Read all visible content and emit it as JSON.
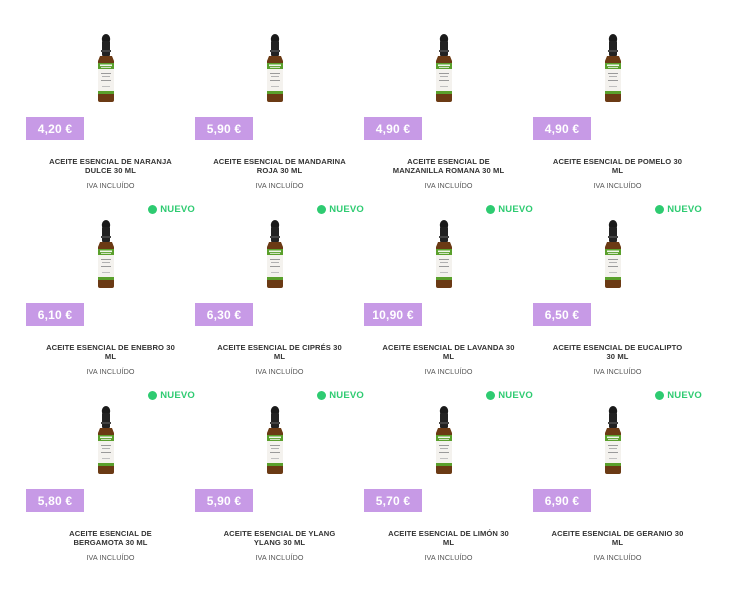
{
  "products": [
    {
      "title": "ACEITE ESENCIAL DE NARANJA DULCE 30 ML",
      "price": "4,20 €",
      "iva": "IVA INCLUÍDO",
      "badge": ""
    },
    {
      "title": "ACEITE ESENCIAL DE MANDARINA ROJA 30 ML",
      "price": "5,90 €",
      "iva": "IVA INCLUÍDO",
      "badge": ""
    },
    {
      "title": "ACEITE ESENCIAL DE MANZANILLA ROMANA 30 ML",
      "price": "4,90 €",
      "iva": "IVA INCLUÍDO",
      "badge": ""
    },
    {
      "title": "ACEITE ESENCIAL DE POMELO 30 ML",
      "price": "4,90 €",
      "iva": "IVA INCLUÍDO",
      "badge": ""
    },
    {
      "title": "ACEITE ESENCIAL DE ENEBRO 30 ML",
      "price": "6,10 €",
      "iva": "IVA INCLUÍDO",
      "badge": "NUEVO"
    },
    {
      "title": "ACEITE ESENCIAL DE CIPRÉS 30 ML",
      "price": "6,30 €",
      "iva": "IVA INCLUÍDO",
      "badge": "NUEVO"
    },
    {
      "title": "ACEITE ESENCIAL DE LAVANDA 30 ML",
      "price": "10,90 €",
      "iva": "IVA INCLUÍDO",
      "badge": "NUEVO"
    },
    {
      "title": "ACEITE ESENCIAL DE EUCALIPTO 30 ML",
      "price": "6,50 €",
      "iva": "IVA INCLUÍDO",
      "badge": "NUEVO"
    },
    {
      "title": "ACEITE ESENCIAL DE BERGAMOTA 30 ML",
      "price": "5,80 €",
      "iva": "IVA INCLUÍDO",
      "badge": "NUEVO"
    },
    {
      "title": "ACEITE ESENCIAL DE YLANG YLANG 30 ML",
      "price": "5,90 €",
      "iva": "IVA INCLUÍDO",
      "badge": "NUEVO"
    },
    {
      "title": "ACEITE ESENCIAL DE LIMÓN 30 ML",
      "price": "5,70 €",
      "iva": "IVA INCLUÍDO",
      "badge": "NUEVO"
    },
    {
      "title": "ACEITE ESENCIAL DE GERANIO 30 ML",
      "price": "6,90 €",
      "iva": "IVA INCLUÍDO",
      "badge": "NUEVO"
    }
  ],
  "colors": {
    "price_bg": "#c79ae6",
    "badge_green": "#2ecb71",
    "bottle_glass": "#6b3a14",
    "label_green": "#5aa02c"
  },
  "icons": {
    "product_image": "essential-oil-dropper-bottle",
    "badge_dot": "green-dot"
  }
}
